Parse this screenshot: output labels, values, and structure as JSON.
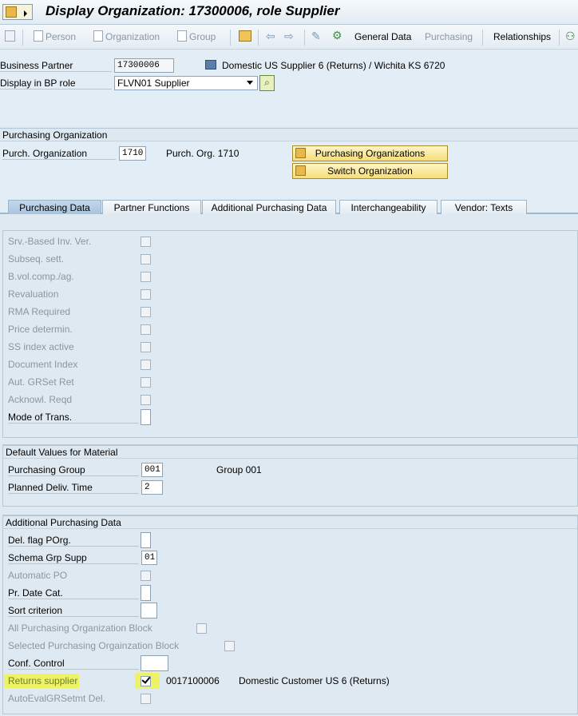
{
  "window": {
    "title": "Display Organization: 17300006, role Supplier"
  },
  "toolbar": {
    "person": "Person",
    "organization": "Organization",
    "group": "Group",
    "general_data": "General Data",
    "purchasing": "Purchasing",
    "relationships": "Relationships"
  },
  "header": {
    "bp_label": "Business Partner",
    "bp_value": "17300006",
    "bp_description": "Domestic US Supplier 6 (Returns) / Wichita KS 6720",
    "role_label": "Display in BP role",
    "role_value": "FLVN01 Supplier"
  },
  "purch_org": {
    "section_title": "Purchasing Organization",
    "label": "Purch. Organization",
    "value": "1710",
    "description": "Purch. Org. 1710",
    "btn_orgs": "Purchasing Organizations",
    "btn_switch": "Switch Organization"
  },
  "tabs": [
    {
      "label": "Purchasing Data"
    },
    {
      "label": "Partner Functions"
    },
    {
      "label": "Additional Purchasing Data"
    },
    {
      "label": "Interchangeability"
    },
    {
      "label": "Vendor: Texts"
    }
  ],
  "control_fields": [
    {
      "label": "Srv.-Based Inv. Ver."
    },
    {
      "label": "Subseq. sett."
    },
    {
      "label": "B.vol.comp./ag."
    },
    {
      "label": "Revaluation"
    },
    {
      "label": "RMA Required"
    },
    {
      "label": "Price determin."
    },
    {
      "label": "SS index active"
    },
    {
      "label": "Document Index"
    },
    {
      "label": "Aut. GRSet Ret"
    },
    {
      "label": "Acknowl. Reqd"
    },
    {
      "label": "Mode of Trans."
    }
  ],
  "defaults": {
    "section_title": "Default Values for Material",
    "group_label": "Purchasing Group",
    "group_value": "001",
    "group_description": "Group 001",
    "deliv_label": "Planned Deliv. Time",
    "deliv_value": "2"
  },
  "additional": {
    "section_title": "Additional Purchasing Data",
    "del_flag": "Del. flag POrg.",
    "schema_label": "Schema Grp Supp",
    "schema_value": "01",
    "auto_po": "Automatic PO",
    "pr_date": "Pr. Date Cat.",
    "sort": "Sort criterion",
    "all_block": "All Purchasing Organization Block",
    "sel_block": "Selected Purchasing Orgainzation Block",
    "conf_control": "Conf. Control",
    "returns_label": "Returns supplier",
    "returns_customer": "0017100006",
    "returns_customer_desc": "Domestic Customer US 6 (Returns)",
    "auto_eval": "AutoEvalGRSetmt Del."
  }
}
